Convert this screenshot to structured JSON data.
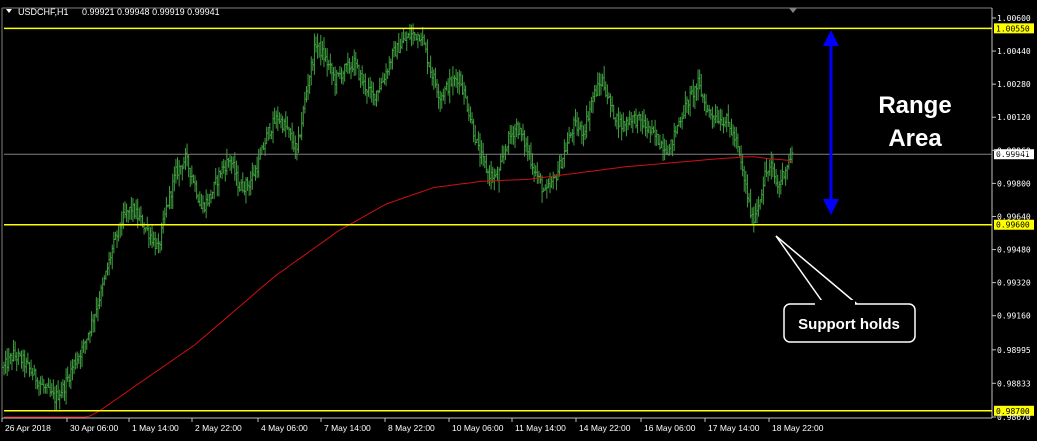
{
  "header": {
    "symbol_timeframe": "USDCHF,H1",
    "ohlc": "0.99921 0.99948 0.99919 0.99941"
  },
  "colors": {
    "background": "#000000",
    "bars": "#3f9f3f",
    "moving_average": "#d01010",
    "levels": "#ffff00",
    "annotation_arrow": "#0000ff",
    "axis_text": "#ffffff"
  },
  "annotations": {
    "range_label_line1": "Range",
    "range_label_line2": "Area",
    "callout": "Support holds"
  },
  "chart_data": {
    "type": "ohlc",
    "symbol": "USDCHF",
    "timeframe": "H1",
    "ylim": [
      0.9867,
      1.006
    ],
    "y_ticks": [
      "1.00600",
      "1.00440",
      "1.00280",
      "1.00120",
      "0.99960",
      "0.99800",
      "0.99640",
      "0.99480",
      "0.99320",
      "0.99160",
      "0.98995",
      "0.98833",
      "0.98670"
    ],
    "x_ticks": [
      "26 Apr 2018",
      "30 Apr 06:00",
      "1 May 14:00",
      "2 May 22:00",
      "4 May 06:00",
      "7 May 14:00",
      "8 May 22:00",
      "10 May 06:00",
      "11 May 14:00",
      "14 May 22:00",
      "16 May 06:00",
      "17 May 14:00",
      "18 May 22:00"
    ],
    "levels": [
      {
        "label": "1.00550",
        "value": 1.0055
      },
      {
        "label": "0.99600",
        "value": 0.996
      },
      {
        "label": "0.98700",
        "value": 0.987
      }
    ],
    "current_price": {
      "label": "0.99941",
      "value": 0.99941
    },
    "close_path": [
      [
        0,
        0.9891
      ],
      [
        6,
        0.9897
      ],
      [
        12,
        0.9894
      ],
      [
        18,
        0.9888
      ],
      [
        25,
        0.9881
      ],
      [
        32,
        0.9876
      ],
      [
        38,
        0.9882
      ],
      [
        44,
        0.9893
      ],
      [
        50,
        0.9901
      ],
      [
        56,
        0.9915
      ],
      [
        62,
        0.993
      ],
      [
        68,
        0.9948
      ],
      [
        74,
        0.9962
      ],
      [
        80,
        0.9968
      ],
      [
        86,
        0.9962
      ],
      [
        92,
        0.9955
      ],
      [
        97,
        0.9948
      ],
      [
        102,
        0.9968
      ],
      [
        108,
        0.9985
      ],
      [
        114,
        0.9992
      ],
      [
        119,
        0.9982
      ],
      [
        124,
        0.9968
      ],
      [
        130,
        0.9974
      ],
      [
        136,
        0.9986
      ],
      [
        142,
        0.9992
      ],
      [
        148,
        0.9978
      ],
      [
        154,
        0.998
      ],
      [
        160,
        0.999
      ],
      [
        166,
        1.0005
      ],
      [
        172,
        1.0012
      ],
      [
        178,
        1.0006
      ],
      [
        184,
        0.9995
      ],
      [
        190,
        1.0025
      ],
      [
        196,
        1.0048
      ],
      [
        202,
        1.004
      ],
      [
        208,
        1.003
      ],
      [
        214,
        1.0035
      ],
      [
        220,
        1.0038
      ],
      [
        226,
        1.0028
      ],
      [
        232,
        1.0022
      ],
      [
        238,
        1.003
      ],
      [
        244,
        1.0042
      ],
      [
        250,
        1.0048
      ],
      [
        256,
        1.0052
      ],
      [
        262,
        1.0052
      ],
      [
        268,
        1.0035
      ],
      [
        274,
        1.0022
      ],
      [
        280,
        1.0028
      ],
      [
        286,
        1.0032
      ],
      [
        292,
        1.0015
      ],
      [
        298,
        0.9996
      ],
      [
        304,
        0.9985
      ],
      [
        310,
        0.9982
      ],
      [
        316,
        1.0
      ],
      [
        322,
        1.0008
      ],
      [
        328,
        0.9998
      ],
      [
        334,
        0.9985
      ],
      [
        340,
        0.9975
      ],
      [
        346,
        0.9982
      ],
      [
        352,
        0.9995
      ],
      [
        358,
        1.0008
      ],
      [
        364,
        1.0005
      ],
      [
        370,
        1.0022
      ],
      [
        376,
        1.003
      ],
      [
        382,
        1.0015
      ],
      [
        388,
        1.0008
      ],
      [
        394,
        1.0012
      ],
      [
        400,
        1.001
      ],
      [
        406,
        1.0005
      ],
      [
        412,
        1.0
      ],
      [
        418,
        0.9996
      ],
      [
        424,
        1.001
      ],
      [
        430,
        1.002
      ],
      [
        436,
        1.0028
      ],
      [
        442,
        1.0015
      ],
      [
        448,
        1.0012
      ],
      [
        454,
        1.001
      ],
      [
        460,
        1.0
      ],
      [
        466,
        0.9978
      ],
      [
        470,
        0.9962
      ],
      [
        474,
        0.997
      ],
      [
        478,
        0.9984
      ],
      [
        482,
        0.9988
      ],
      [
        486,
        0.9978
      ],
      [
        490,
        0.9986
      ],
      [
        495,
        0.9994
      ]
    ],
    "moving_average": [
      [
        0,
        0.9845
      ],
      [
        60,
        0.987
      ],
      [
        120,
        0.9902
      ],
      [
        170,
        0.9935
      ],
      [
        210,
        0.9957
      ],
      [
        240,
        0.997
      ],
      [
        270,
        0.9978
      ],
      [
        300,
        0.9981
      ],
      [
        330,
        0.9982
      ],
      [
        360,
        0.9985
      ],
      [
        390,
        0.9988
      ],
      [
        420,
        0.999
      ],
      [
        450,
        0.9992
      ],
      [
        470,
        0.9993
      ],
      [
        480,
        0.9992
      ],
      [
        495,
        0.9991
      ]
    ]
  }
}
